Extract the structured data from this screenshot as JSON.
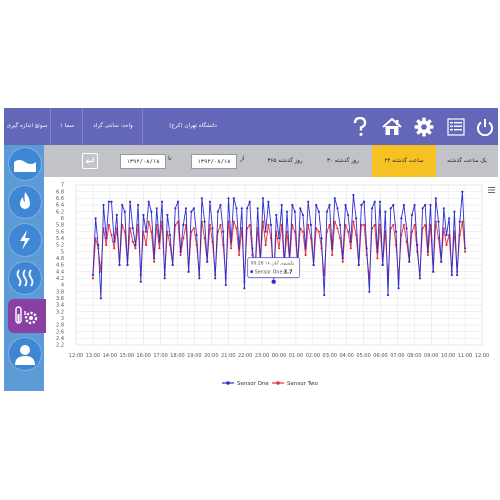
{
  "topbar": {
    "company": "سوئچ اندازه گیری",
    "info1": "سما ۱",
    "info2": "واحد: سانتی گراد",
    "info3": "دانشگاه تهران (کرج)",
    "icons": [
      "power-icon",
      "report-icon",
      "settings-icon",
      "home-icon",
      "help-icon"
    ]
  },
  "toolbar": {
    "tabs": [
      "یک ساعت گذشته",
      "۲۴ ساعت گذشته",
      "۳۰ روز گذشته",
      "۳۶۵ روز گذشته"
    ],
    "active_tab": 1,
    "from_label": "از",
    "to_label": "تا",
    "date_from": "۱۳۹۴/۰۸/۱۸",
    "date_to": "۱۳۹۴/۰۸/۱۸"
  },
  "sidebar": {
    "items": [
      "water-icon",
      "fire-icon",
      "electricity-icon",
      "heat-icon",
      "sensor-settings-icon",
      "user-icon"
    ],
    "active": 4
  },
  "colors": {
    "series1": "#2d2fd0",
    "series2": "#e8303a",
    "accent": "#f6c223",
    "topbar": "#6466b8"
  },
  "chart_data": {
    "type": "line",
    "y_ticks": [
      "7",
      "6.8",
      "6.6",
      "6.4",
      "6.2",
      "6",
      "5.8",
      "5.6",
      "5.4",
      "5.2",
      "5",
      "4.8",
      "4.6",
      "4.4",
      "4.2",
      "4",
      "3.8",
      "3.6",
      "3.4",
      "3.2",
      "3",
      "2.8",
      "2.6",
      "2.4",
      "2.2"
    ],
    "ylim": [
      2.2,
      7
    ],
    "x_ticks": [
      "12:00",
      "13:00",
      "14:00",
      "15:00",
      "16:00",
      "17:00",
      "18:00",
      "19:00",
      "20:00",
      "21:00",
      "22:00",
      "23:00",
      "00:00",
      "01:00",
      "02:00",
      "03:00",
      "04:00",
      "05:00",
      "06:00",
      "07:00",
      "08:00",
      "09:00",
      "10:00",
      "11:00",
      "12:00"
    ],
    "x_range": [
      0,
      24
    ],
    "series": [
      {
        "name": "Sensor One",
        "color": "#2d2fd0",
        "values": [
          4.3,
          6,
          5.2,
          3.6,
          6.4,
          5.4,
          6.5,
          6.5,
          5.3,
          6.1,
          4.6,
          6.4,
          6.2,
          4.6,
          6.5,
          5.7,
          5.2,
          6.4,
          4.1,
          6.1,
          5.6,
          6.5,
          6.2,
          4.8,
          6.3,
          5.3,
          6.5,
          4.2,
          6.1,
          5.5,
          4.6,
          6.3,
          6.5,
          5,
          5.8,
          6.3,
          4.4,
          6.2,
          6.3,
          5.5,
          4.2,
          6.6,
          5.9,
          4.7,
          6.5,
          5.7,
          4.2,
          6.2,
          6.4,
          5.6,
          4,
          6.6,
          5.3,
          6.6,
          6.3,
          5.1,
          6.3,
          3.9,
          6.3,
          6.5,
          5.1,
          4.4,
          6.3,
          4.7,
          6.6,
          5.6,
          6.5,
          5.8,
          4.1,
          6.1,
          5.4,
          6.4,
          4.6,
          6.2,
          4.8,
          6.4,
          6.2,
          4.6,
          6.3,
          6.1,
          5.1,
          6.5,
          5.8,
          4.6,
          6.4,
          6.2,
          5.4,
          3.7,
          6.2,
          6.4,
          5.1,
          6.6,
          6.3,
          5.8,
          4.8,
          6.4,
          6.1,
          5.3,
          6.7,
          6,
          4.6,
          6.4,
          6.5,
          5.1,
          3.8,
          6.3,
          6.5,
          5,
          6.5,
          4.6,
          6.2,
          3.7,
          6.3,
          6.4,
          5.6,
          3.9,
          6,
          6.4,
          5.7,
          4.7,
          6.1,
          6.4,
          5.2,
          4.2,
          6.3,
          6.4,
          5,
          6.4,
          4.4,
          6.6,
          5.9,
          4.7,
          6.3,
          5.5,
          6,
          4.3,
          6.2,
          4.3,
          5.9,
          6.8,
          5.1
        ]
      },
      {
        "name": "Sensor Two",
        "color": "#e8303a",
        "values": [
          4.2,
          5.4,
          5.1,
          4.4,
          5.7,
          5.2,
          5.8,
          5.5,
          5.1,
          5.7,
          4.6,
          5.8,
          5.6,
          4.6,
          5.7,
          5.3,
          5.1,
          5.8,
          4.3,
          5.6,
          5.2,
          5.9,
          5.6,
          4.7,
          5.8,
          5.1,
          5.9,
          4.3,
          5.6,
          5.2,
          4.6,
          5.8,
          5.9,
          4.9,
          5.4,
          5.8,
          4.4,
          5.6,
          5.7,
          5.2,
          4.3,
          5.9,
          5.4,
          4.7,
          5.8,
          5.3,
          4.3,
          5.6,
          5.8,
          5.2,
          4.2,
          5.9,
          5.1,
          5.9,
          5.7,
          4.9,
          5.7,
          4.1,
          5.7,
          5.8,
          4.9,
          4.4,
          5.7,
          4.7,
          5.9,
          5.2,
          5.8,
          5.4,
          4.2,
          5.6,
          5.1,
          5.8,
          4.6,
          5.6,
          4.7,
          5.8,
          5.6,
          4.6,
          5.7,
          5.6,
          4.9,
          5.8,
          5.4,
          4.6,
          5.7,
          5.6,
          5.1,
          4.3,
          5.6,
          5.8,
          4.9,
          5.9,
          5.7,
          5.4,
          4.7,
          5.8,
          5.6,
          5.1,
          5.9,
          5.5,
          4.6,
          5.8,
          5.8,
          4.9,
          4.2,
          5.7,
          5.8,
          4.8,
          5.8,
          4.6,
          5.6,
          4.2,
          5.7,
          5.8,
          5.2,
          4.2,
          5.5,
          5.8,
          5.3,
          4.7,
          5.6,
          5.8,
          5,
          4.3,
          5.7,
          5.8,
          4.9,
          5.8,
          4.4,
          5.9,
          5.4,
          4.7,
          5.7,
          5.2,
          5.5,
          4.4,
          5.6,
          4.4,
          5.5,
          5.9,
          5
        ]
      }
    ],
    "tooltip": {
      "time": "یکشنبه, آبان ۱۸ 00:26",
      "label": "Sensor One:",
      "value": "3.7"
    },
    "legend_position": "bottom-center"
  }
}
